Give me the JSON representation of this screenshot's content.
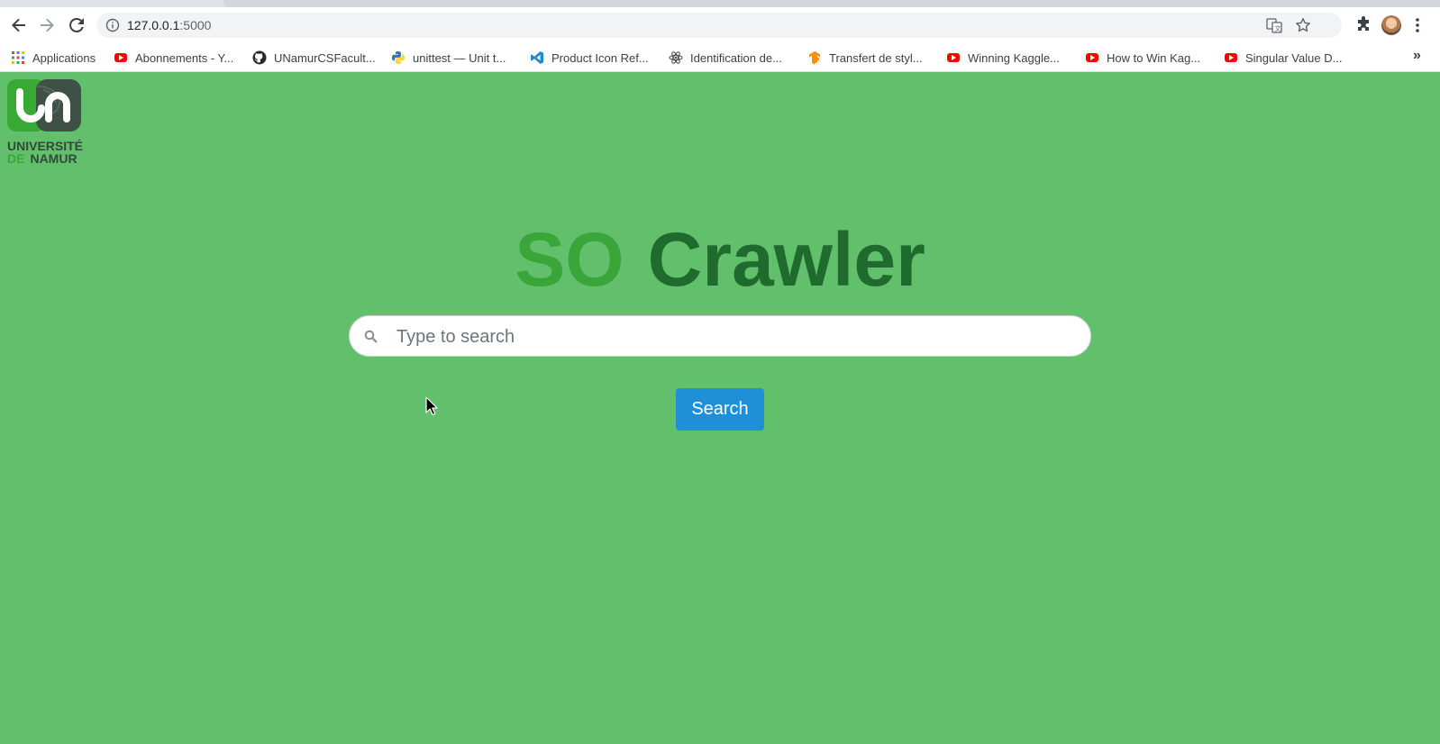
{
  "browser": {
    "address": "127.0.0.1",
    "address_port": ":5000",
    "bookmarks": [
      {
        "label": "Applications",
        "icon": "apps-grid-icon"
      },
      {
        "label": "Abonnements - Y...",
        "icon": "youtube-icon"
      },
      {
        "label": "UNamurCSFacult...",
        "icon": "github-icon"
      },
      {
        "label": "unittest — Unit t...",
        "icon": "python-icon"
      },
      {
        "label": "Product Icon Ref...",
        "icon": "vscode-icon"
      },
      {
        "label": "Identification de...",
        "icon": "atom-icon"
      },
      {
        "label": "Transfert de styl...",
        "icon": "tensorflow-icon"
      },
      {
        "label": "Winning Kaggle...",
        "icon": "youtube-icon"
      },
      {
        "label": "How to Win Kag...",
        "icon": "youtube-icon"
      },
      {
        "label": "Singular Value D...",
        "icon": "youtube-icon"
      }
    ],
    "more_bookmarks": "»"
  },
  "logo": {
    "line1": "UNIVERSITÉ",
    "line2_a": "DE",
    "line2_b": "NAMUR"
  },
  "title": {
    "part1": "SO",
    "part2": "Crawler"
  },
  "search": {
    "placeholder": "Type to search",
    "value": "",
    "button_label": "Search"
  },
  "colors": {
    "page_background": "#62bf6b",
    "title_so": "#3aa63a",
    "title_crawler": "#1e6b2d",
    "button": "#1f8fd8"
  }
}
